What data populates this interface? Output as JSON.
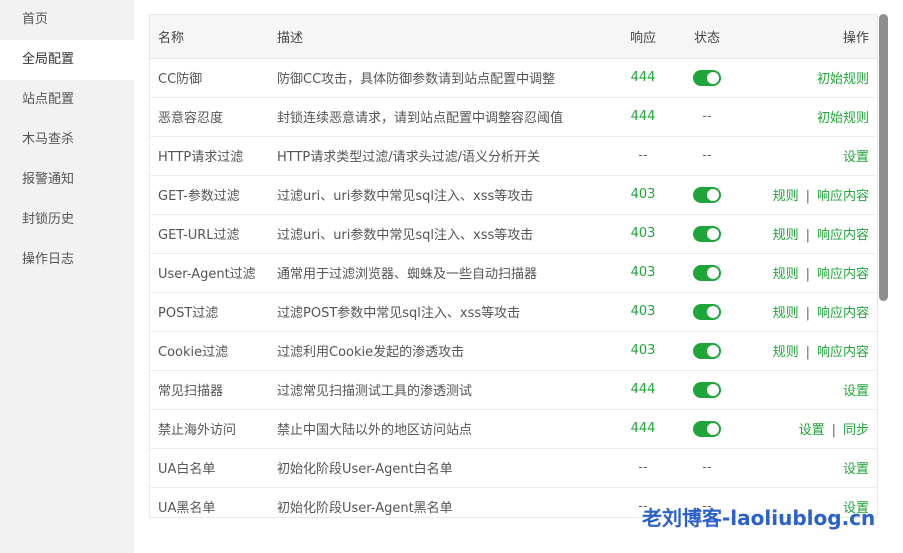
{
  "sidebar": {
    "items": [
      {
        "label": "首页"
      },
      {
        "label": "全局配置"
      },
      {
        "label": "站点配置"
      },
      {
        "label": "木马查杀"
      },
      {
        "label": "报警通知"
      },
      {
        "label": "封锁历史"
      },
      {
        "label": "操作日志"
      }
    ]
  },
  "table": {
    "headers": {
      "name": "名称",
      "desc": "描述",
      "resp": "响应",
      "status": "状态",
      "ops": "操作"
    },
    "rows": [
      {
        "name": "CC防御",
        "desc": "防御CC攻击，具体防御参数请到站点配置中调整",
        "resp": "444",
        "status": "on",
        "ops": [
          "初始规则"
        ]
      },
      {
        "name": "恶意容忍度",
        "desc": "封锁连续恶意请求，请到站点配置中调整容忍阈值",
        "resp": "444",
        "status": "--",
        "ops": [
          "初始规则"
        ]
      },
      {
        "name": "HTTP请求过滤",
        "desc": "HTTP请求类型过滤/请求头过滤/语义分析开关",
        "resp": "--",
        "status": "--",
        "ops": [
          "设置"
        ]
      },
      {
        "name": "GET-参数过滤",
        "desc": "过滤uri、uri参数中常见sql注入、xss等攻击",
        "resp": "403",
        "status": "on",
        "ops": [
          "规则",
          "响应内容"
        ]
      },
      {
        "name": "GET-URL过滤",
        "desc": "过滤uri、uri参数中常见sql注入、xss等攻击",
        "resp": "403",
        "status": "on",
        "ops": [
          "规则",
          "响应内容"
        ]
      },
      {
        "name": "User-Agent过滤",
        "desc": "通常用于过滤浏览器、蜘蛛及一些自动扫描器",
        "resp": "403",
        "status": "on",
        "ops": [
          "规则",
          "响应内容"
        ]
      },
      {
        "name": "POST过滤",
        "desc": "过滤POST参数中常见sql注入、xss等攻击",
        "resp": "403",
        "status": "on",
        "ops": [
          "规则",
          "响应内容"
        ]
      },
      {
        "name": "Cookie过滤",
        "desc": "过滤利用Cookie发起的渗透攻击",
        "resp": "403",
        "status": "on",
        "ops": [
          "规则",
          "响应内容"
        ]
      },
      {
        "name": "常见扫描器",
        "desc": "过滤常见扫描测试工具的渗透测试",
        "resp": "444",
        "status": "on",
        "ops": [
          "设置"
        ]
      },
      {
        "name": "禁止海外访问",
        "desc": "禁止中国大陆以外的地区访问站点",
        "resp": "444",
        "status": "on",
        "ops": [
          "设置",
          "同步"
        ]
      },
      {
        "name": "UA白名单",
        "desc": "初始化阶段User-Agent白名单",
        "resp": "--",
        "status": "--",
        "ops": [
          "设置"
        ]
      },
      {
        "name": "UA黑名单",
        "desc": "初始化阶段User-Agent黑名单",
        "resp": "--",
        "status": "--",
        "ops": [
          "设置"
        ]
      }
    ]
  },
  "watermark": "老刘博客-laoliublog.cn",
  "colors": {
    "accent": "#20a53a",
    "sidebar_bg": "#f2f2f2",
    "watermark": "#2b61c9"
  }
}
